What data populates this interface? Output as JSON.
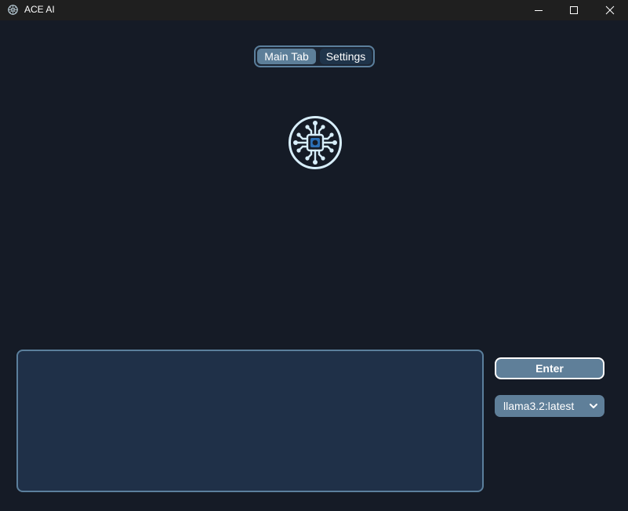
{
  "window": {
    "title": "ACE AI",
    "controls": [
      "minimize",
      "maximize",
      "close"
    ]
  },
  "tabs": [
    {
      "label": "Main Tab",
      "selected": true
    },
    {
      "label": "Settings",
      "selected": false
    }
  ],
  "logo": {
    "icon": "ai-chip-icon"
  },
  "input": {
    "value": "",
    "placeholder": ""
  },
  "enter_button": {
    "label": "Enter"
  },
  "model_select": {
    "selected": "llama3.2:latest"
  },
  "colors": {
    "background": "#151b26",
    "titlebar": "#1f1f1f",
    "accent": "#5f7f99",
    "input_fill": "#1f3048",
    "border": "#5b7f9c",
    "logo": "#d7eefb",
    "logo_core": "#2b6fb5"
  }
}
